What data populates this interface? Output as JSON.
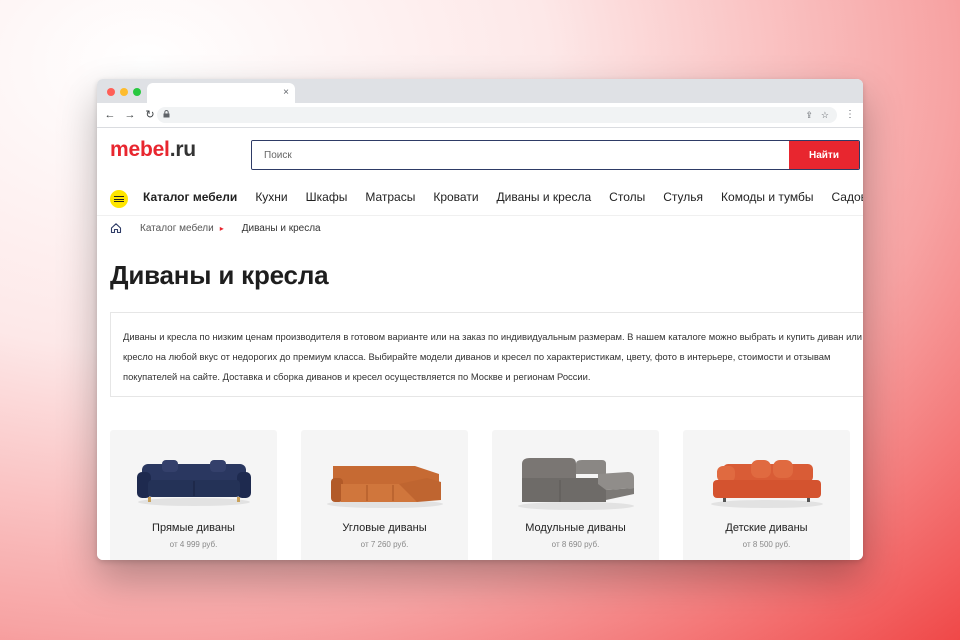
{
  "browser": {
    "tab_close": "×",
    "nav": {
      "back": "←",
      "forward": "→",
      "reload": "↻"
    },
    "lock": "🔒",
    "share": "⇪",
    "star": "☆",
    "menu": "⋮",
    "traffic_lights": [
      "#ff5f57",
      "#febc2e",
      "#28c840"
    ]
  },
  "site": {
    "logo": {
      "part1": "mebel",
      "part2": ".ru"
    },
    "search": {
      "placeholder": "Поиск",
      "button": "Найти"
    },
    "menu": [
      "Каталог мебели",
      "Кухни",
      "Шкафы",
      "Матрасы",
      "Кровати",
      "Диваны и кресла",
      "Столы",
      "Стулья",
      "Комоды и тумбы",
      "Садовая мебель"
    ],
    "breadcrumb": {
      "parent": "Каталог мебели",
      "separator": "▸",
      "current": "Диваны и кресла"
    },
    "title": "Диваны и кресла",
    "description": [
      "Диваны и кресла по низким ценам производителя в готовом варианте или на заказ по индивидуальным размерам. В нашем каталоге можно выбрать и купить диван или",
      "кресло на любой вкус от недорогих до премиум класса. Выбирайте модели диванов и кресел по характеристикам, цвету, фото в интерьере, стоимости и отзывам",
      "покупателей на сайте. Доставка и сборка диванов и кресел осуществляется по Москве и регионам России."
    ],
    "categories": [
      {
        "title": "Прямые диваны",
        "price": "от 4 999 руб.",
        "icon": "straight-sofa",
        "color": "#1e2a4f"
      },
      {
        "title": "Угловые диваны",
        "price": "от 7 260 руб.",
        "icon": "corner-sofa",
        "color": "#b85c2a"
      },
      {
        "title": "Модульные диваны",
        "price": "от 8 690 руб.",
        "icon": "modular-sofa",
        "color": "#6e6b68"
      },
      {
        "title": "Детские диваны",
        "price": "от 8 500 руб.",
        "icon": "kids-sofa",
        "color": "#d4532f"
      }
    ],
    "accent_color": "#e8262f"
  }
}
